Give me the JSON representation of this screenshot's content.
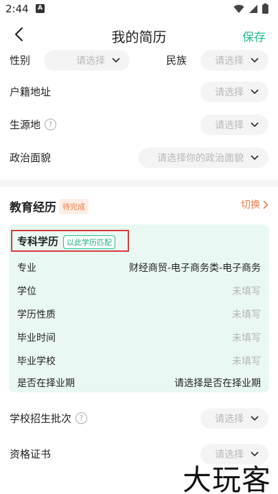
{
  "status_bar": {
    "time": "2:44",
    "notification_letter": "A"
  },
  "nav": {
    "title": "我的简历",
    "save_label": "保存"
  },
  "basic_info": {
    "gender": {
      "label": "性别",
      "placeholder": "请选择"
    },
    "ethnicity": {
      "label": "民族",
      "placeholder": "请选择"
    },
    "household": {
      "label": "户籍地址",
      "placeholder": "请选择"
    },
    "origin": {
      "label": "生源地",
      "placeholder": "请选择",
      "help": "?"
    },
    "politics": {
      "label": "政治面貌",
      "placeholder": "请选择你的政治面貌"
    }
  },
  "education": {
    "title": "教育经历",
    "status": "待完成",
    "switch_label": "切换",
    "degree": "专科学历",
    "match_badge": "以此学历匹配",
    "rows": [
      {
        "label": "专业",
        "value": "财经商贸-电子商务类-电子商务"
      },
      {
        "label": "学位",
        "value": "未填写"
      },
      {
        "label": "学历性质",
        "value": "未填写"
      },
      {
        "label": "毕业时间",
        "value": "未填写"
      },
      {
        "label": "毕业学校",
        "value": "未填写"
      },
      {
        "label": "是否在择业期",
        "value": "请选择是否在择业期"
      }
    ]
  },
  "extra": {
    "batch": {
      "label": "学校招生批次",
      "placeholder": "请选择",
      "help": "?"
    },
    "certificate": {
      "label": "资格证书",
      "placeholder": "请选择"
    }
  },
  "watermark": "大玩客",
  "colors": {
    "accent": "#1fbe8f",
    "warning": "#f07a47",
    "card_bg": "#e9f8f2",
    "highlight_box": "#d93a3a"
  }
}
